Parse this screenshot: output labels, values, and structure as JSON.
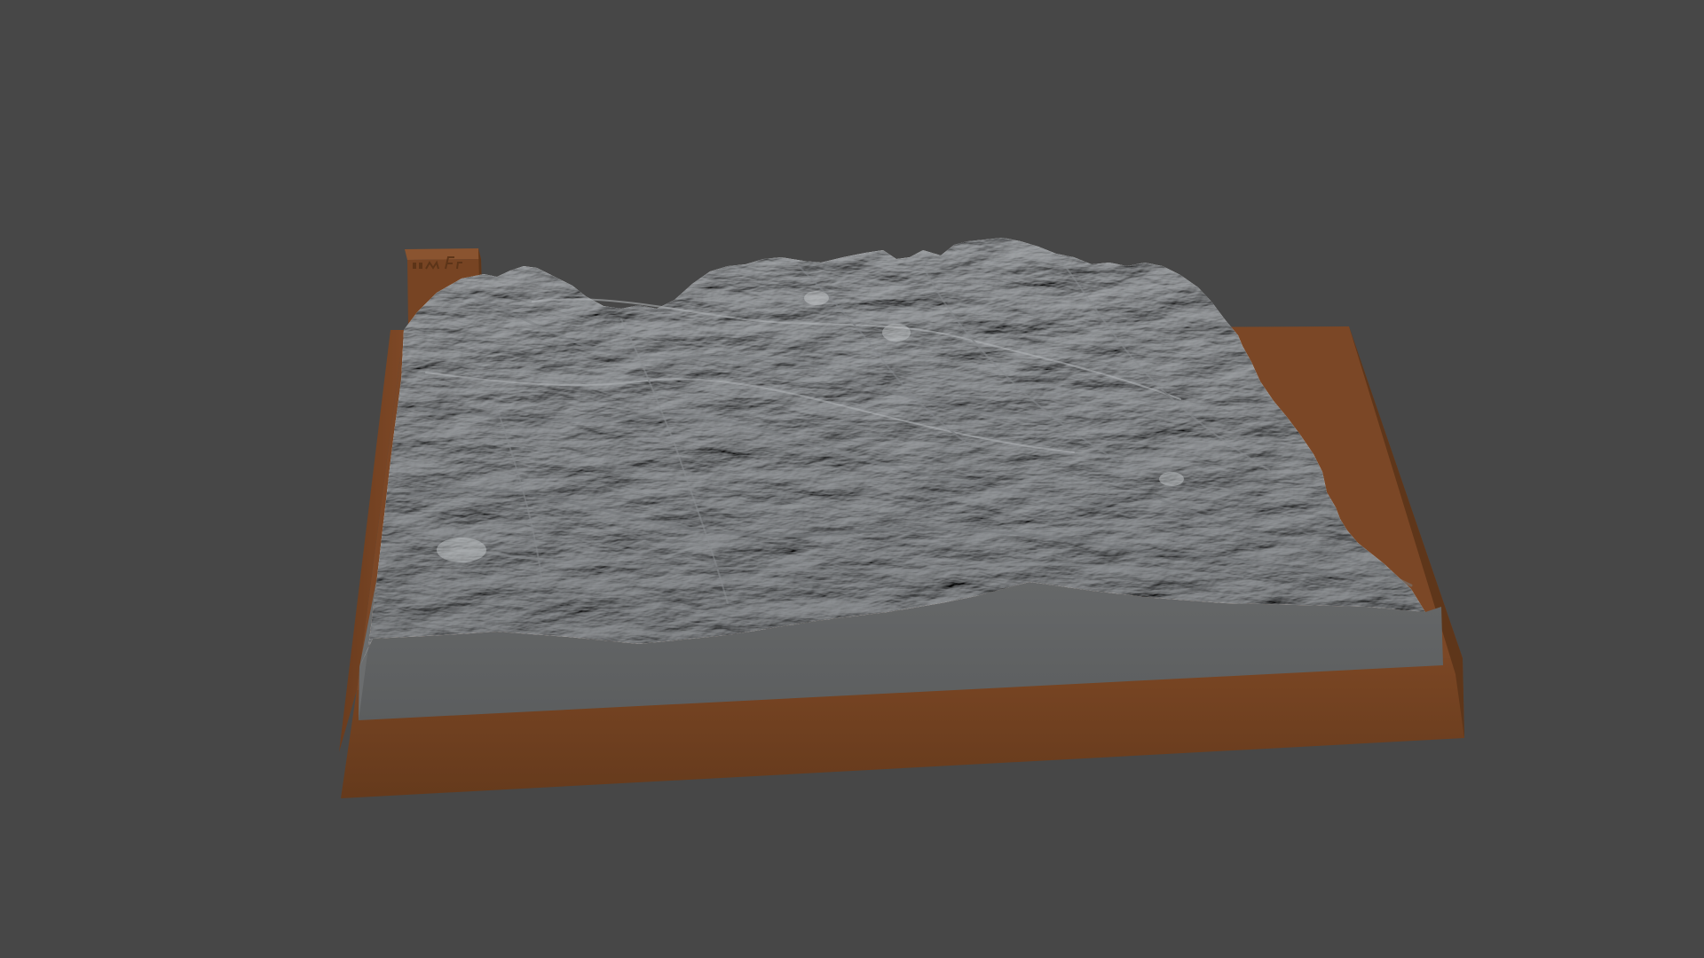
{
  "viewport": {
    "background_color": "#474747"
  },
  "model": {
    "name": "",
    "base_color": "#6e3f1f",
    "terrain_color": "#9ea1a4",
    "terrain_side_color": "#5f6162",
    "tag_lettering": "E M  F r"
  }
}
